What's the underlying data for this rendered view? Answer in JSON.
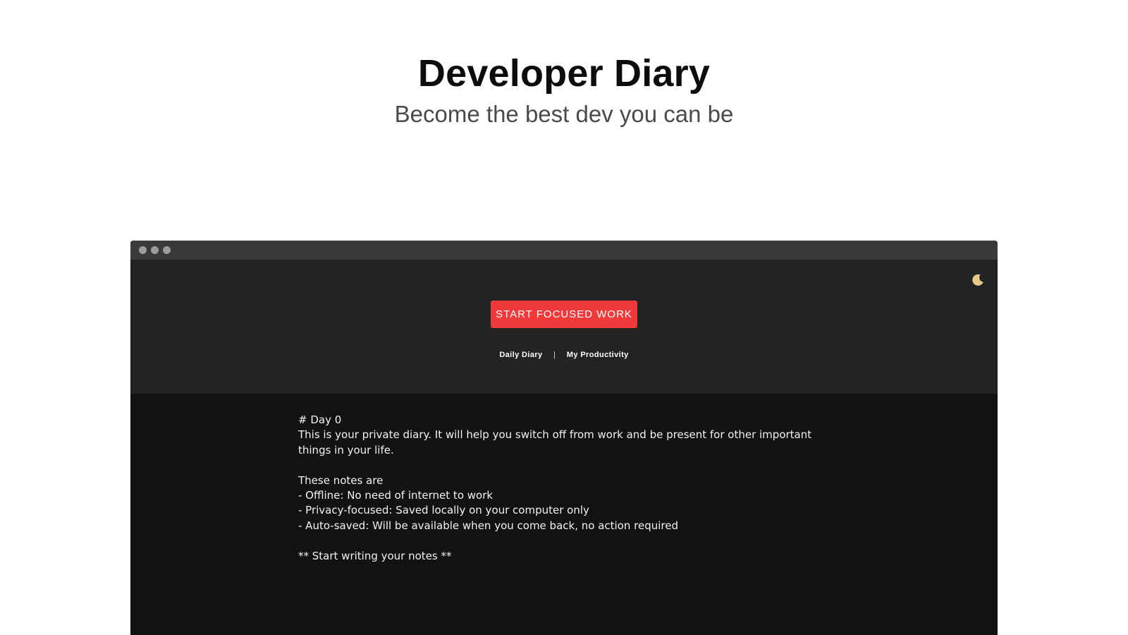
{
  "hero": {
    "title": "Developer Diary",
    "subtitle": "Become the best dev you can be"
  },
  "window": {
    "theme_toggle_icon": "crescent-moon-icon",
    "focus_button_label": "START FOCUSED WORK",
    "nav": {
      "items": [
        "Daily Diary",
        "My Productivity"
      ],
      "separator": "|"
    },
    "editor": {
      "lines": [
        "# Day 0",
        "This is your private diary. It will help you switch off from work and be present for other important",
        "things in your life.",
        "",
        "These notes are",
        "- Offline: No need of internet to work",
        "- Privacy-focused: Saved locally on your computer only",
        "- Auto-saved: Will be available when you come back, no action required",
        "",
        "** Start writing your notes **"
      ]
    }
  },
  "colors": {
    "accent": "#f0393a",
    "header_bg": "#232323",
    "editor_bg": "#121212",
    "titlebar_bg": "#3a3a3b",
    "moon": "#e8c98a"
  }
}
